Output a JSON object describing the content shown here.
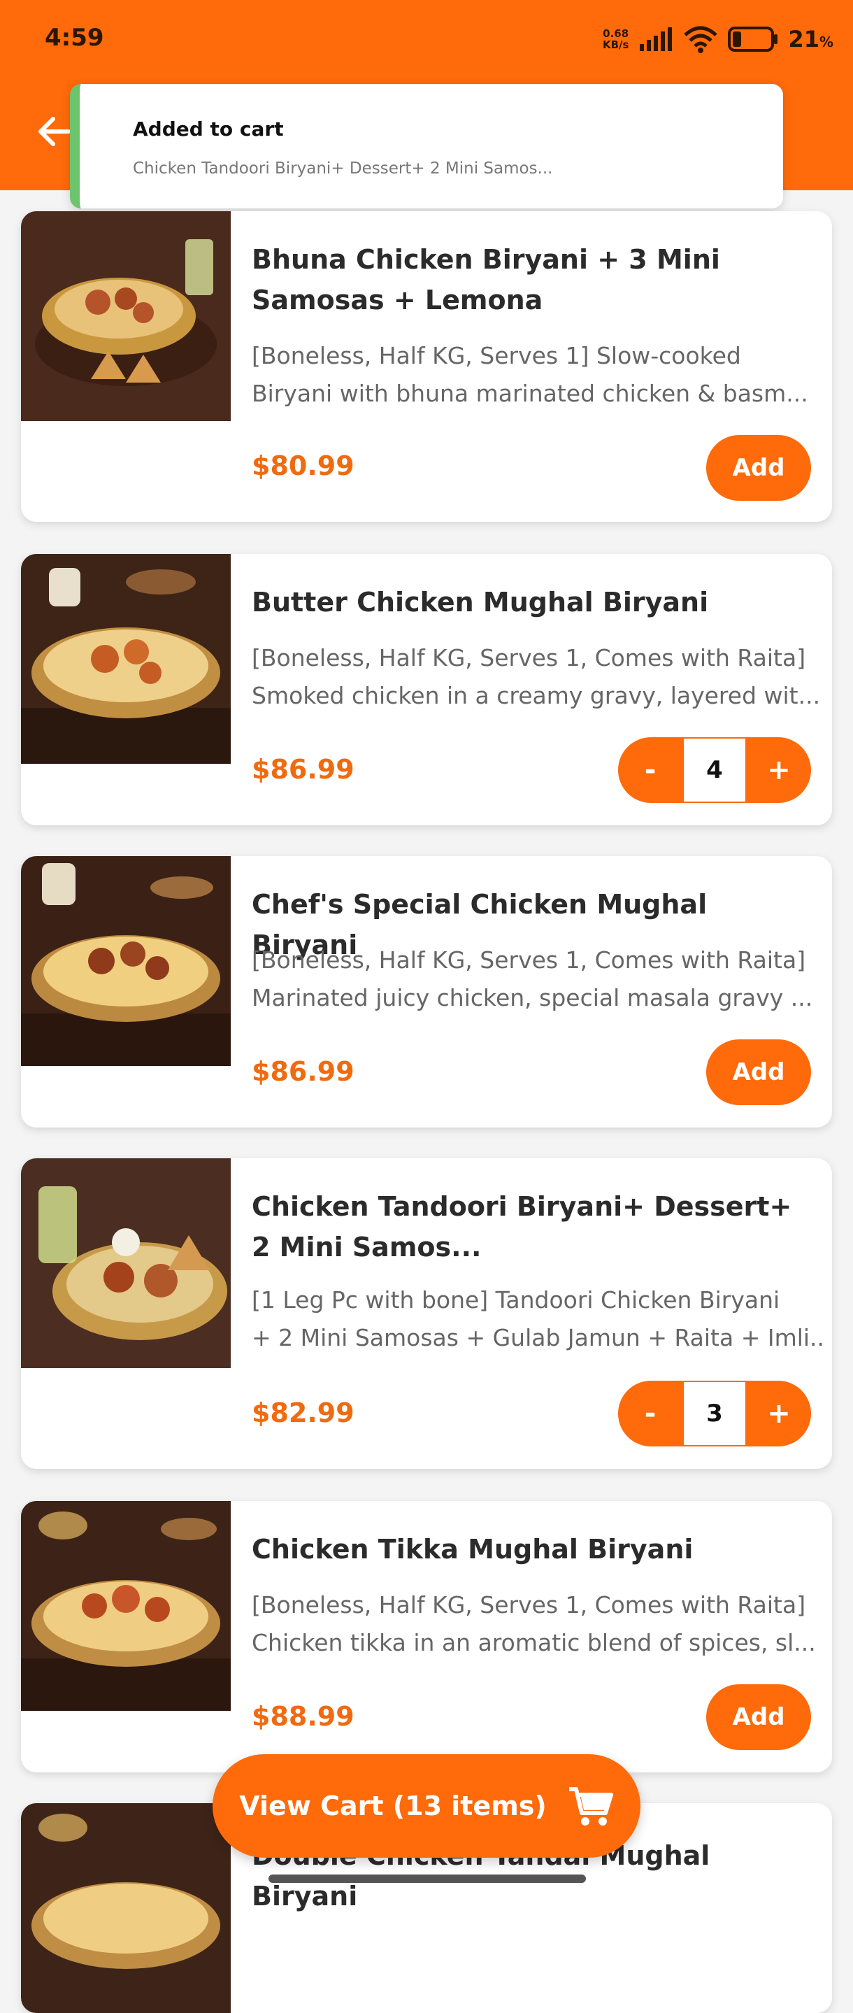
{
  "status_bar": {
    "time": "4:59",
    "net_speed_value": "0.68",
    "net_speed_unit": "KB/s",
    "battery_value": "21",
    "battery_unit": "%"
  },
  "toast": {
    "title": "Added to cart",
    "message": "Chicken Tandoori Biryani+ Dessert+ 2 Mini Samos..."
  },
  "colors": {
    "accent": "#ff6a0a",
    "price": "#f06a0f",
    "toast_bar": "#6cc46c"
  },
  "items": [
    {
      "title": "Bhuna Chicken Biryani + 3 Mini Samosas + Lemona",
      "desc_line1": "[Boneless, Half KG, Serves 1] Slow-cooked",
      "desc_line2": "Biryani with bhuna marinated chicken & basm...",
      "price": "$80.99",
      "action": "Add"
    },
    {
      "title": "Butter Chicken Mughal Biryani",
      "desc_line1": "[Boneless, Half KG, Serves 1, Comes with Raita]",
      "desc_line2": "Smoked chicken in a creamy gravy, layered wit...",
      "price": "$86.99",
      "minus": "-",
      "qty": "4",
      "plus": "+"
    },
    {
      "title": "Chef's Special Chicken Mughal Biryani",
      "desc_line1": "[Boneless, Half KG, Serves 1, Comes with Raita]",
      "desc_line2": "Marinated juicy chicken, special masala gravy ...",
      "price": "$86.99",
      "action": "Add"
    },
    {
      "title": "Chicken Tandoori Biryani+ Dessert+ 2 Mini Samos...",
      "desc_line1": "[1 Leg Pc with bone] Tandoori Chicken Biryani",
      "desc_line2": "+ 2 Mini Samosas + Gulab Jamun + Raita + Imli...",
      "price": "$82.99",
      "minus": "-",
      "qty": "3",
      "plus": "+"
    },
    {
      "title": "Chicken Tikka Mughal Biryani",
      "desc_line1": "[Boneless, Half KG, Serves 1, Comes with Raita]",
      "desc_line2": "Chicken tikka in an aromatic blend of spices, sl...",
      "price": "$88.99",
      "action": "Add"
    },
    {
      "title": "Double Chicken Tandai Mughal Biryani"
    }
  ],
  "view_cart": {
    "label": "View Cart (13 items)",
    "icon": "cart-icon"
  }
}
